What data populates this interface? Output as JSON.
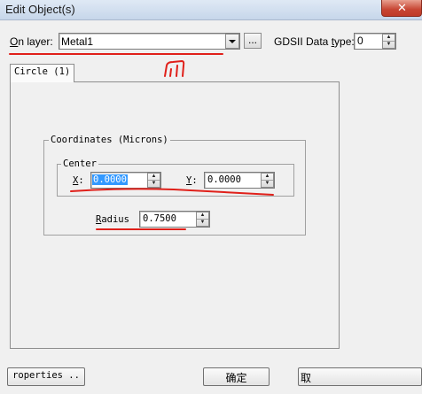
{
  "window": {
    "title": "Edit Object(s)",
    "close_glyph": "✕"
  },
  "layer": {
    "label_prefix": "O",
    "label_rest": "n layer:",
    "value": "Metal1",
    "ellipsis": "..."
  },
  "gdsii": {
    "label_prefix": "GDSII Data ",
    "label_underlined": "t",
    "label_rest": "ype:",
    "value": "0"
  },
  "tab": {
    "label": "Circle (1)"
  },
  "coordinates": {
    "group_title": "Coordinates (Microns)",
    "center_title": "Center",
    "x_label": "X",
    "x_colon": ":",
    "x_value": "0.0000",
    "y_label": "Y",
    "y_colon": ":",
    "y_value": "0.0000",
    "radius_label_underlined": "R",
    "radius_label_rest": "adius",
    "radius_value": "0.7500"
  },
  "buttons": {
    "properties_label": "roperties ..",
    "ok_label": "确定",
    "cancel_label": "取"
  },
  "annotation": {
    "color": "#e0201a"
  }
}
